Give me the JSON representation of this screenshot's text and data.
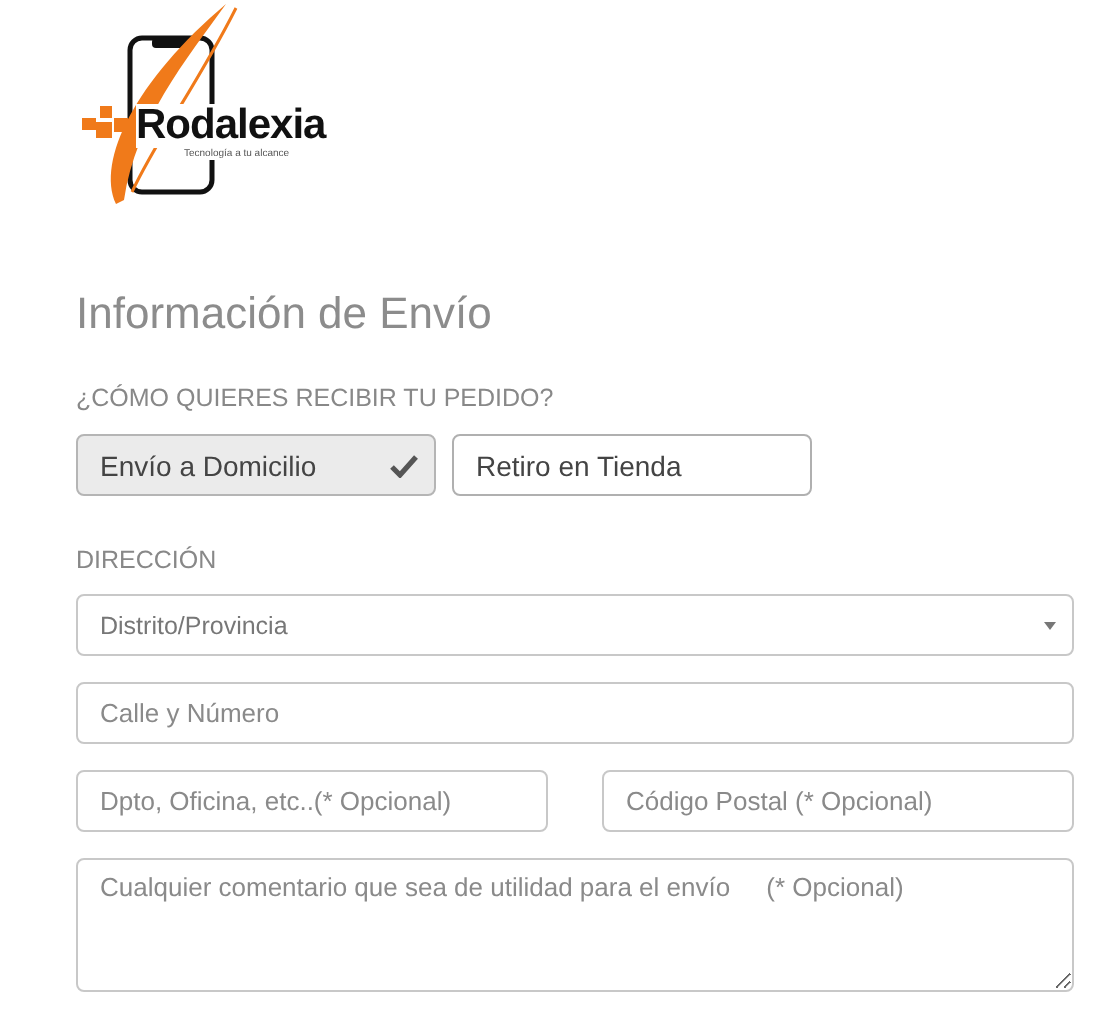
{
  "logo": {
    "name": "Rodalexia",
    "tagline": "Tecnología a tu alcance"
  },
  "title": "Información de Envío",
  "delivery": {
    "label": "¿CÓMO QUIERES RECIBIR TU PEDIDO?",
    "options": [
      {
        "label": "Envío a Domicilio",
        "selected": true
      },
      {
        "label": "Retiro en Tienda",
        "selected": false
      }
    ]
  },
  "address": {
    "label": "DIRECCIÓN",
    "district": {
      "placeholder": "Distrito/Provincia"
    },
    "street": {
      "placeholder": "Calle y Número"
    },
    "unit": {
      "placeholder": "Dpto, Oficina, etc..(* Opcional)"
    },
    "postal_code": {
      "placeholder": "Código Postal (* Opcional)"
    },
    "comment": {
      "placeholder": "Cualquier comentario que sea de utilidad para el envío     (* Opcional)"
    }
  }
}
